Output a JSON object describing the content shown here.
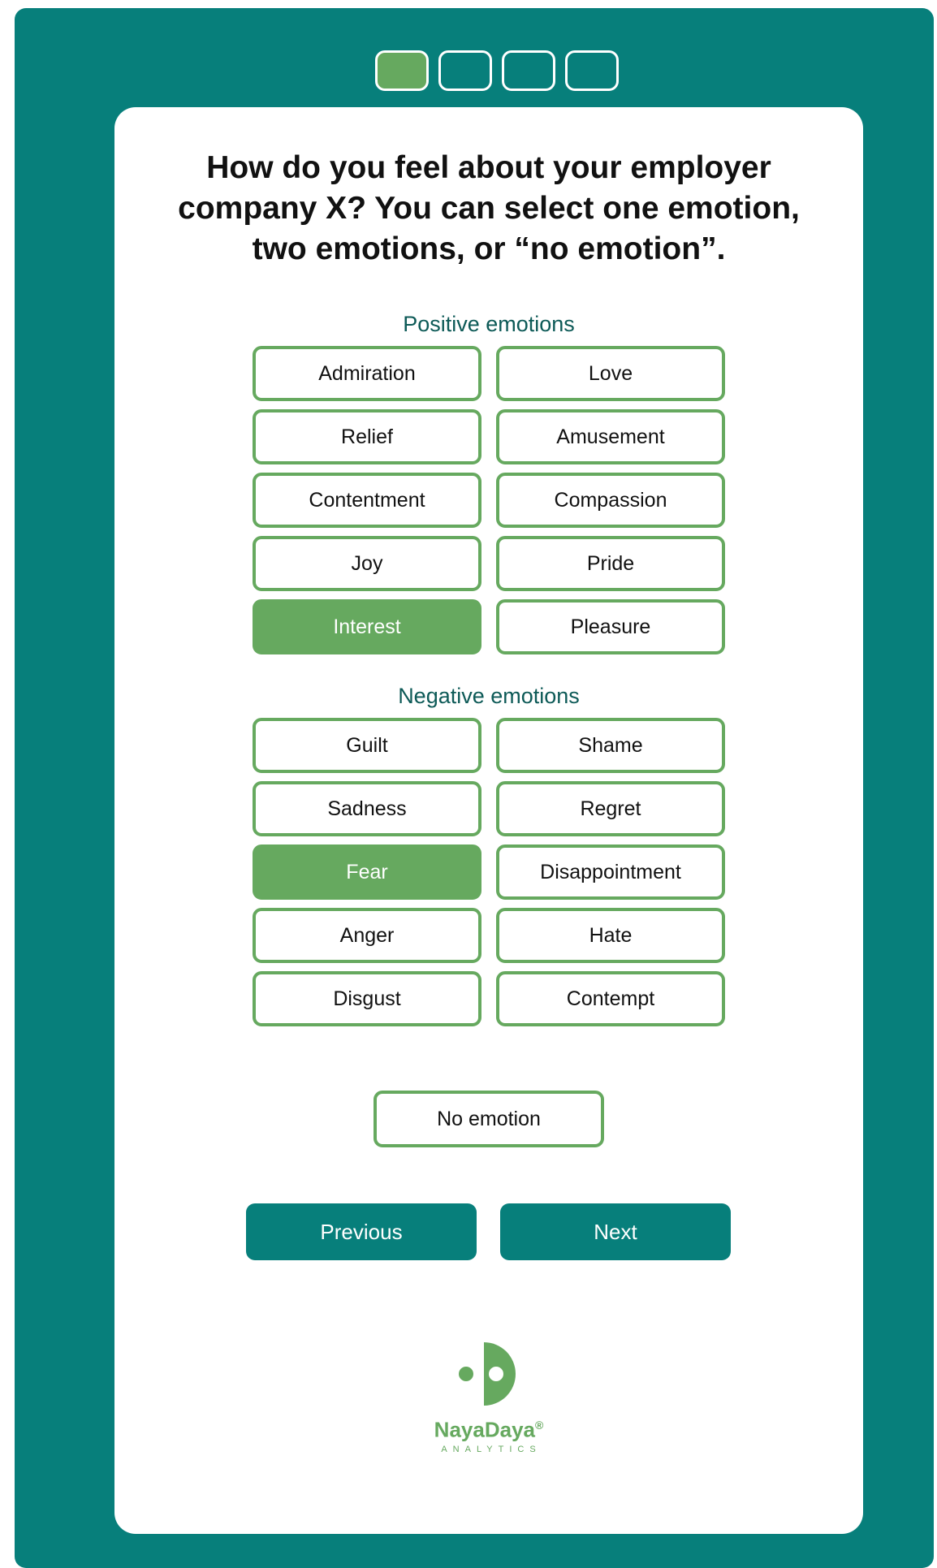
{
  "progress": {
    "total_steps": 4,
    "current_step": 1
  },
  "question": "How do you feel about your employer company X? You can select one emotion, two emotions, or “no emotion”.",
  "positive": {
    "title": "Positive emotions",
    "options": [
      "Admiration",
      "Love",
      "Relief",
      "Amusement",
      "Contentment",
      "Compassion",
      "Joy",
      "Pride",
      "Interest",
      "Pleasure"
    ],
    "selected": [
      "Interest"
    ]
  },
  "negative": {
    "title": "Negative emotions",
    "options": [
      "Guilt",
      "Shame",
      "Sadness",
      "Regret",
      "Fear",
      "Disappointment",
      "Anger",
      "Hate",
      "Disgust",
      "Contempt"
    ],
    "selected": [
      "Fear"
    ]
  },
  "no_emotion_label": "No emotion",
  "nav": {
    "previous_label": "Previous",
    "next_label": "Next"
  },
  "logo": {
    "brand": "NayaDaya",
    "mark": "®",
    "tagline": "ANALYTICS"
  },
  "colors": {
    "teal": "#077f7b",
    "green": "#66a95f",
    "heading": "#0d5a57"
  }
}
